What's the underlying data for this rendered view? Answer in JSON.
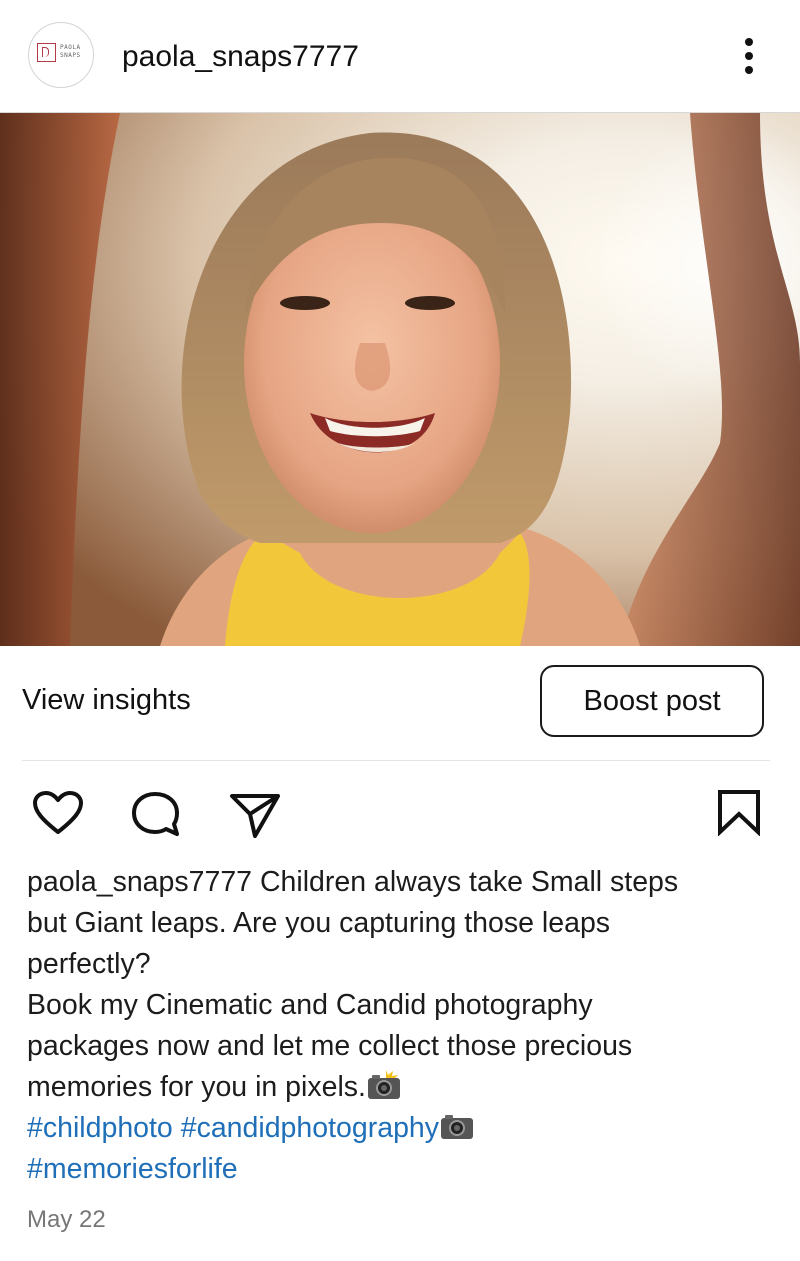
{
  "header": {
    "avatar_text": "PAOLA SNAPS",
    "avatar_line1": "PAOLA",
    "avatar_line2": "SNAPS",
    "username": "paola_snaps7777",
    "more_icon": "more-vertical-icon"
  },
  "post": {
    "photo_icon": "photo-image",
    "view_insights_label": "View insights",
    "boost_label": "Boost post",
    "icons": [
      "heart-icon",
      "comment-icon",
      "share-icon",
      "bookmark-icon"
    ]
  },
  "caption": {
    "username": "paola_snaps7777",
    "line1_text": " Children always take Small steps",
    "line2": "but Giant leaps. Are you capturing those leaps",
    "line3": "perfectly?",
    "line4": "Book my Cinematic and Candid photography",
    "line5": "packages now and let me collect those precious",
    "line6": "memories for you in pixels.",
    "emoji_icon": "camera-flash-icon",
    "hashtags": [
      "#childphoto",
      "#candidphotography",
      "#memoriesforlife"
    ],
    "hashtag_emoji_icon": "camera-icon"
  },
  "meta": {
    "date": "May 22"
  },
  "colors": {
    "hashtag": "#1f6fb8",
    "date": "#777777",
    "text": "#111111"
  }
}
